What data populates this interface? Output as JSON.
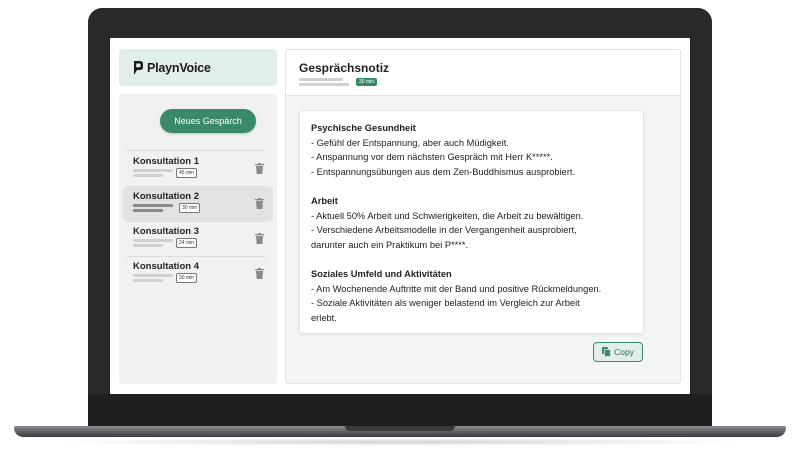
{
  "brand": {
    "name": "PlaynVoice",
    "accent": "#3a8a6a"
  },
  "sidebar": {
    "new_button": "Neues Gespärch",
    "conversations": [
      {
        "title": "Konsultation 1",
        "duration": "45 min",
        "active": false
      },
      {
        "title": "Konsultation 2",
        "duration": "30 min",
        "active": true
      },
      {
        "title": "Konsultation 3",
        "duration": "24 min",
        "active": false
      },
      {
        "title": "Konsultation 4",
        "duration": "30 min",
        "active": false
      }
    ]
  },
  "main": {
    "title": "Gesprächsnotiz",
    "duration_badge": "30 min",
    "sections": [
      {
        "heading": "Psychische Gesundheit",
        "lines": [
          "- Gefühl der Entspannung, aber auch Müdigkeit.",
          "- Anspannung vor dem nächsten Gespräch mit Herr K*****.",
          "- Entspannungsübungen aus dem Zen-Buddhismus ausprobiert."
        ]
      },
      {
        "heading": "Arbeit",
        "lines": [
          "- Aktuell 50% Arbeit und Schwierigkeiten, die Arbeit zu bewältigen.",
          "- Verschiedene Arbeitsmodelle in der Vergangenheit ausprobiert,",
          "darunter auch ein Praktikum bei P****."
        ]
      },
      {
        "heading": "Soziales Umfeld und Aktivitäten",
        "lines": [
          "- Am Wochenende Auftritte mit der Band und positive Rückmeldungen.",
          "- Soziale Aktivitäten als weniger belastend im Vergleich zur Arbeit",
          "erlebt."
        ]
      }
    ],
    "copy_button": "Copy"
  },
  "icons": {
    "logo": "playnvoice-logo-icon",
    "trash": "trash-icon",
    "copy": "copy-icon"
  }
}
